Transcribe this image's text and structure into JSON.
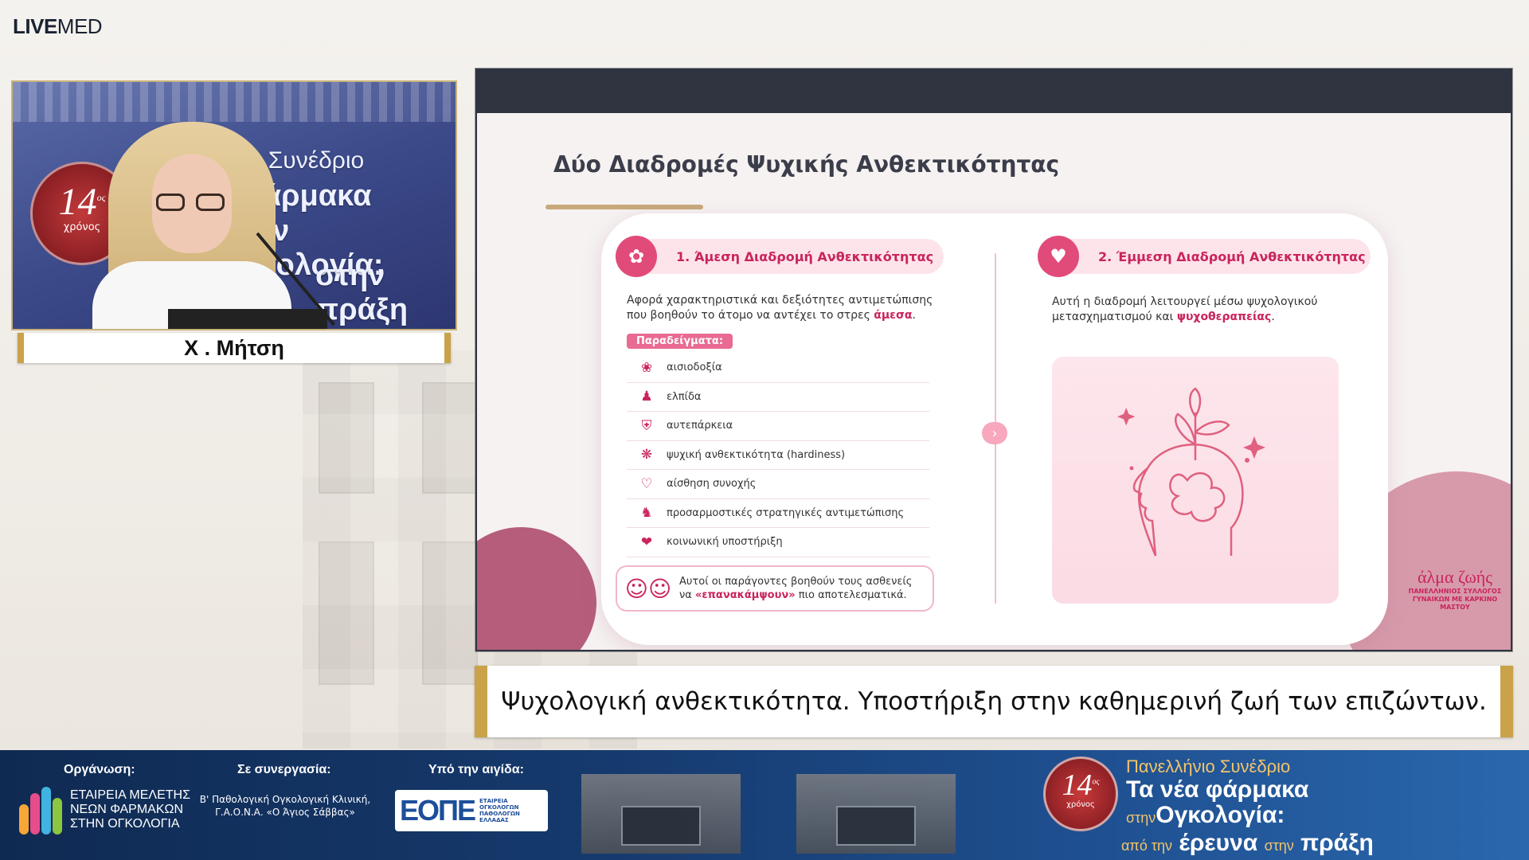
{
  "brand": {
    "bold": "LIVE",
    "thin": "MED"
  },
  "video": {
    "seal_number": "14",
    "seal_sup": "ος",
    "seal_word": "χρόνος",
    "bg_line1": "Πανελλήνιο Συνέδριο",
    "bg_line2": "Τα νέα φάρμακα",
    "bg_line3": "στην Ογκολογία:",
    "bg_line4": "στην πράξη"
  },
  "speaker": {
    "name": "Χ . Μήτση"
  },
  "slide": {
    "title": "Δύο Διαδρομές Ψυχικής Ανθεκτικότητας",
    "left": {
      "heading": "1. Άμεση Διαδρομή Ανθεκτικότητας",
      "desc_text": "Αφορά χαρακτηριστικά και δεξιότητες αντιμετώπισης που βοηθούν το άτομο να αντέχει το στρες",
      "desc_bold": "άμεσα",
      "desc_end": ".",
      "tag": "Παραδείγματα:",
      "items": [
        {
          "icon": "lotus-icon",
          "label": "αισιοδοξία"
        },
        {
          "icon": "person-arms-icon",
          "label": "ελπίδα"
        },
        {
          "icon": "shield-heart-icon",
          "label": "αυτεπάρκεια"
        },
        {
          "icon": "brain-icon",
          "label": "ψυχική ανθεκτικότητα (hardiness)"
        },
        {
          "icon": "heart-icon",
          "label": "αίσθηση συνοχής"
        },
        {
          "icon": "chess-icon",
          "label": "προσαρμοστικές στρατηγικές αντιμετώπισης"
        },
        {
          "icon": "hands-heart-icon",
          "label": "κοινωνική υποστήριξη"
        }
      ],
      "note_text": "Αυτοί οι παράγοντες βοηθούν τους ασθενείς να",
      "note_bold": "«επανακάμψουν»",
      "note_end": "πιο αποτελεσματικά."
    },
    "right": {
      "heading": "2. Έμμεση Διαδρομή Ανθεκτικότητας",
      "desc_text": "Αυτή η διαδρομή λειτουργεί μέσω ψυχολογικού μετασχηματισμού και",
      "desc_bold": "ψυχοθεραπείας",
      "desc_end": "."
    },
    "logo": {
      "name": "άλμα ζωής",
      "sub1": "ΠΑΝΕΛΛΗΝΙΟΣ ΣΥΛΛΟΓΟΣ",
      "sub2": "ΓΥΝΑΙΚΩΝ ΜΕ ΚΑΡΚΙΝΟ ΜΑΣΤΟΥ"
    }
  },
  "caption": "Ψυχολογική ανθεκτικότητα. Υποστήριξη στην καθημερινή ζωή των επιζώντων.",
  "banner": {
    "org_label": "Οργάνωση:",
    "org_line1": "ΕΤΑΙΡΕΙΑ ΜΕΛΕΤΗΣ",
    "org_line2": "ΝΕΩΝ ΦΑΡΜΑΚΩΝ",
    "org_line3": "ΣΤΗΝ ΟΓΚΟΛΟΓΙΑ",
    "collab_label": "Σε συνεργασία:",
    "collab_line1": "Β' Παθολογική Ογκολογική Κλινική,",
    "collab_line2": "Γ.Α.Ο.Ν.Α. «Ο Άγιος Σάββας»",
    "aegis_label": "Υπό την αιγίδα:",
    "eope_big": "ΕΟΠΕ",
    "eope_small1": "ΕΤΑΙΡΕΙΑ",
    "eope_small2": "ΟΓΚΟΛΟΓΩΝ",
    "eope_small3": "ΠΑΘΟΛΟΓΩΝ",
    "eope_small4": "ΕΛΛΑΔΑΣ",
    "seal_number": "14",
    "seal_sup": "ος",
    "seal_word": "χρόνος",
    "conf_line1": "Πανελλήνιο Συνέδριο",
    "conf_line2": "Τα νέα φάρμακα",
    "conf_small1": "στην",
    "conf_line3": "Ογκολογία:",
    "conf_small2": "από την",
    "conf_line4a": "έρευνα",
    "conf_small3": "στην",
    "conf_line4b": "πράξη"
  },
  "colors": {
    "accent_pink": "#c9245d",
    "gold_frame": "#c9a24a",
    "banner_blue": "#163a6e"
  }
}
